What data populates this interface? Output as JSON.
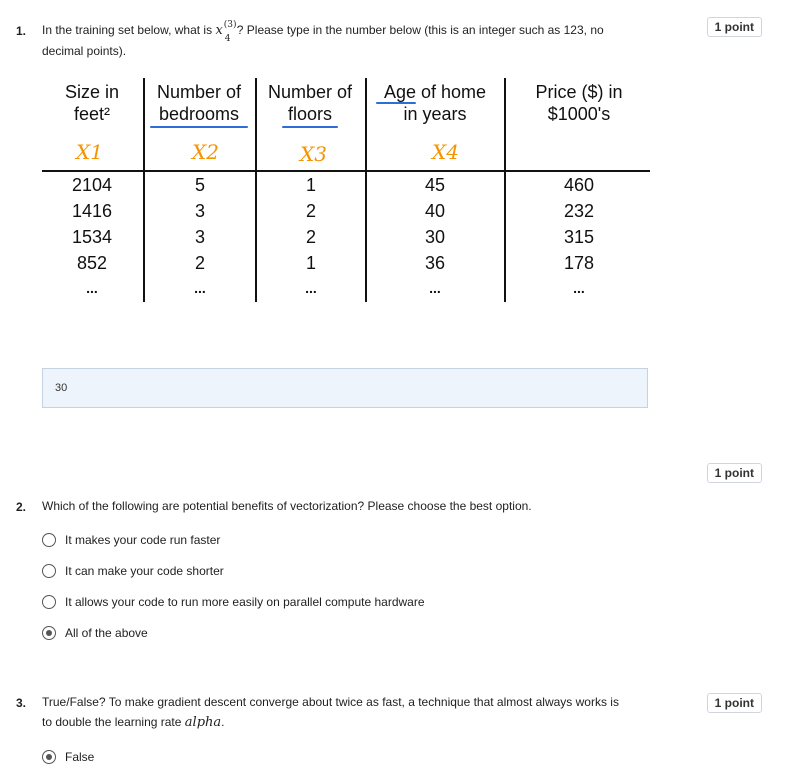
{
  "q1": {
    "number": "1.",
    "text_before": "In the training set below, what is ",
    "math_base": "x",
    "math_sup": "(3)",
    "math_sub": "4",
    "text_after": "? Please type in the number below (this is an integer such as 123, no",
    "text_line2": "decimal points).",
    "points": "1 point",
    "answer_value": "30",
    "table": {
      "headers": [
        [
          "Size in",
          "feet²"
        ],
        [
          "Number of",
          "bedrooms"
        ],
        [
          "Number of",
          "floors"
        ],
        [
          "Age of home",
          "in years"
        ],
        [
          "Price ($) in",
          "$1000's"
        ]
      ],
      "vars": [
        "X1",
        "X2",
        "X3",
        "X4"
      ],
      "rows": [
        [
          "2104",
          "5",
          "1",
          "45",
          "460"
        ],
        [
          "1416",
          "3",
          "2",
          "40",
          "232"
        ],
        [
          "1534",
          "3",
          "2",
          "30",
          "315"
        ],
        [
          "852",
          "2",
          "1",
          "36",
          "178"
        ],
        [
          "...",
          "...",
          "...",
          "...",
          "..."
        ]
      ]
    }
  },
  "q2": {
    "number": "2.",
    "text": "Which of the following are potential benefits of vectorization? Please choose the best option.",
    "points": "1 point",
    "options": [
      {
        "label": "It makes your code run faster",
        "checked": false
      },
      {
        "label": "It can make your code shorter",
        "checked": false
      },
      {
        "label": "It allows your code to run more easily on parallel compute hardware",
        "checked": false
      },
      {
        "label": "All of the above",
        "checked": true
      }
    ]
  },
  "q3": {
    "number": "3.",
    "text_line1": "True/False? To make gradient descent converge about twice as fast, a technique that almost always works is",
    "text_line2_before": "to double the learning rate ",
    "text_line2_math": "alpha",
    "text_line2_after": ".",
    "points": "1 point",
    "options": [
      {
        "label": "False",
        "checked": true
      }
    ]
  }
}
